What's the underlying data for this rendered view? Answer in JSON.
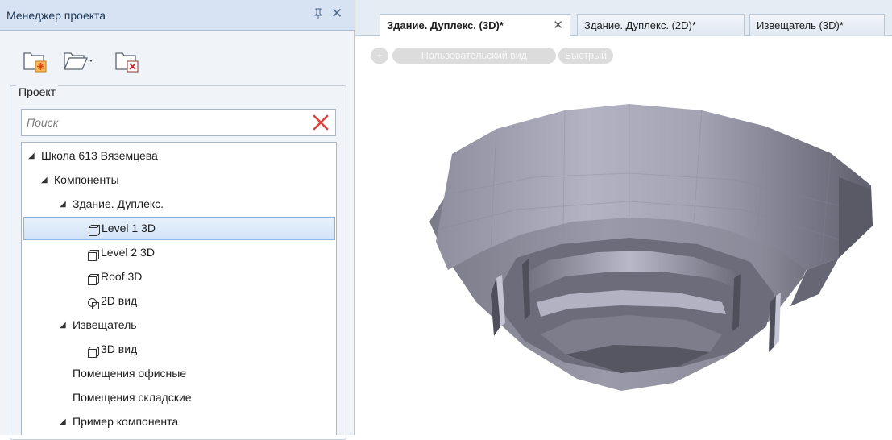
{
  "panel": {
    "title": "Менеджер проекта",
    "pin_glyph": "ꟷ",
    "close_glyph": "✕"
  },
  "toolbar": {
    "items": [
      "new-project-icon",
      "open-project-icon",
      "close-project-icon"
    ]
  },
  "project_group": {
    "label": "Проект"
  },
  "search": {
    "placeholder": "Поиск",
    "value": ""
  },
  "tree": {
    "arrow_glyph": "◢",
    "items": [
      {
        "label": "Школа 613 Вяземцева"
      },
      {
        "label": "Компоненты"
      },
      {
        "label": "Здание. Дуплекс."
      },
      {
        "label": "Level 1 3D"
      },
      {
        "label": "Level 2 3D"
      },
      {
        "label": "Roof 3D"
      },
      {
        "label": "2D вид"
      },
      {
        "label": "Извещатель"
      },
      {
        "label": "3D вид"
      },
      {
        "label": "Помещения офисные"
      },
      {
        "label": "Помещения складские"
      },
      {
        "label": "Пример компонента"
      }
    ],
    "selected_index": 3
  },
  "tabs": [
    {
      "label": "Здание. Дуплекс. (3D)*",
      "active": true
    },
    {
      "label": "Здание. Дуплекс. (2D)*",
      "active": false
    },
    {
      "label": "Извещатель (3D)*",
      "active": false
    }
  ],
  "tab_close_glyph": "✕",
  "view_bar": {
    "add_label": "+",
    "user_view_label": "Пользовательский вид",
    "fast_label": "Быстрый"
  },
  "colors": {
    "panel_header": "#d7e3f2",
    "selection": "#d3e3f8",
    "model_light": "#aaaabc",
    "model_dark": "#5e5e6c"
  }
}
